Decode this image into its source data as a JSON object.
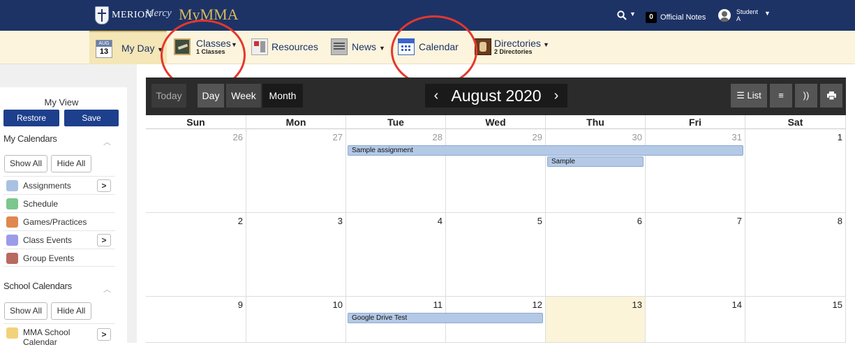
{
  "topbar": {
    "logo_text": "MERION",
    "logo_mercy": "Mercy",
    "logo_mymma": "MyMMA",
    "notes_count": "0",
    "notes_label": "Official Notes",
    "user_name": "Student\nA"
  },
  "nav": {
    "myday": {
      "month": "AUG",
      "day": "13",
      "label": "My Day"
    },
    "classes": {
      "label": "Classes",
      "sub": "1 Classes"
    },
    "resources": {
      "label": "Resources"
    },
    "news": {
      "label": "News"
    },
    "calendar": {
      "label": "Calendar"
    },
    "directories": {
      "label": "Directories",
      "sub": "2 Directories"
    }
  },
  "sidebar": {
    "title": "My View",
    "restore": "Restore",
    "save": "Save",
    "my_calendars": {
      "title": "My Calendars",
      "show_all": "Show All",
      "hide_all": "Hide All",
      "items": [
        {
          "label": "Assignments",
          "color": "#a8c1e2",
          "arrow": ">"
        },
        {
          "label": "Schedule",
          "color": "#7cc78d",
          "arrow": ""
        },
        {
          "label": "Games/Practices",
          "color": "#e0874f",
          "arrow": ""
        },
        {
          "label": "Class Events",
          "color": "#9b9be8",
          "arrow": ">"
        },
        {
          "label": "Group Events",
          "color": "#b96a5e",
          "arrow": ""
        }
      ]
    },
    "school_calendars": {
      "title": "School Calendars",
      "show_all": "Show All",
      "hide_all": "Hide All",
      "items": [
        {
          "label": "MMA School Calendar",
          "color": "#f2d27a",
          "arrow": ">"
        }
      ]
    }
  },
  "calendar": {
    "today": "Today",
    "day": "Day",
    "week": "Week",
    "month": "Month",
    "prev": "‹",
    "next": "›",
    "month_title": "August 2020",
    "list": "List",
    "weekdays": [
      "Sun",
      "Mon",
      "Tue",
      "Wed",
      "Thu",
      "Fri",
      "Sat"
    ],
    "weeks": [
      [
        "26",
        "27",
        "28",
        "29",
        "30",
        "31",
        "1"
      ],
      [
        "2",
        "3",
        "4",
        "5",
        "6",
        "7",
        "8"
      ],
      [
        "9",
        "10",
        "11",
        "12",
        "13",
        "14",
        "15"
      ]
    ],
    "events": {
      "sample_assignment": "Sample assignment",
      "sample": "Sample",
      "google_drive_test": "Google Drive Test"
    }
  },
  "colors": {
    "brand_navy": "#1d3366",
    "nav_bg": "#fcf4dc",
    "annotation_red": "#e5372d",
    "event_blue": "#b3c9e6",
    "today_highlight": "#fbf4d8"
  }
}
